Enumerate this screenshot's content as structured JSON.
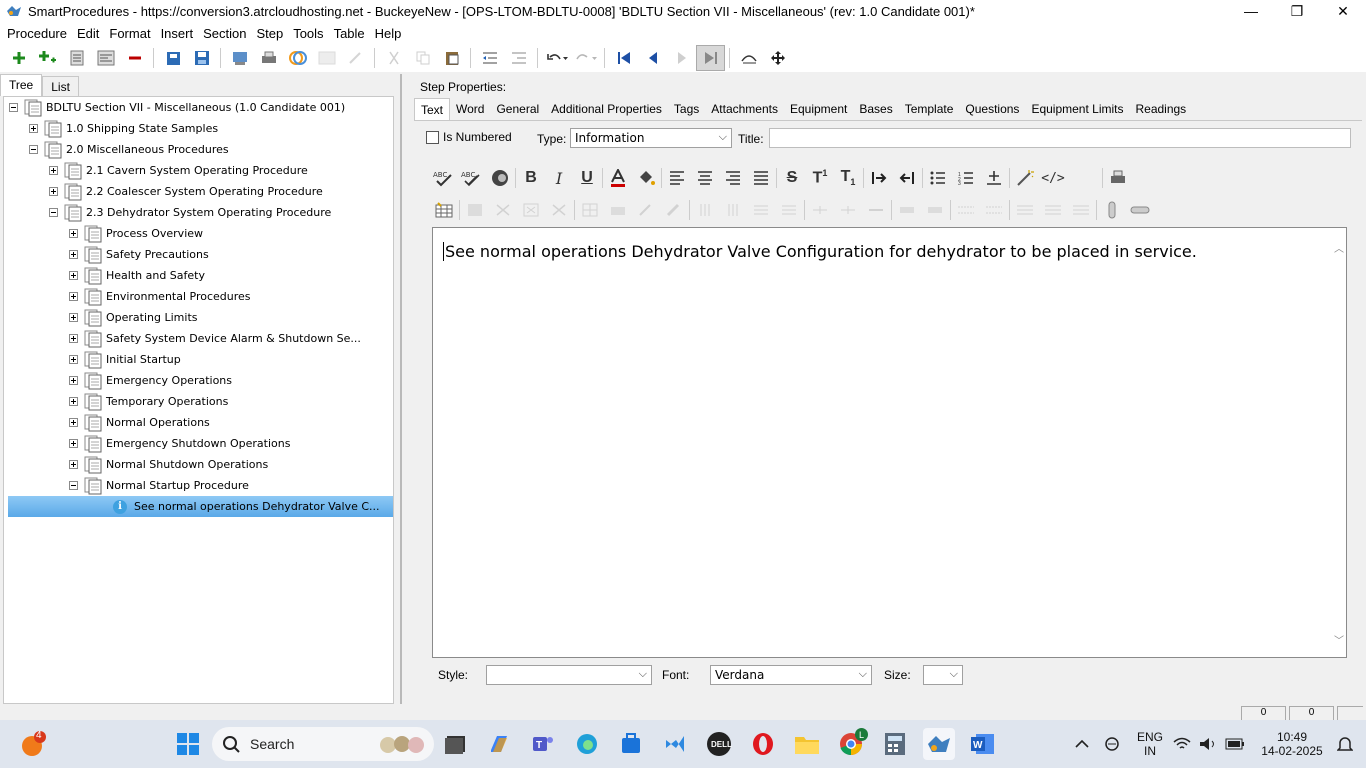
{
  "window": {
    "title": "SmartProcedures - https://conversion3.atrcloudhosting.net - BuckeyeNew - [OPS-LTOM-BDLTU-0008] 'BDLTU Section VII - Miscellaneous' (rev: 1.0 Candidate 001)*",
    "minimize": "—",
    "maximize": "❐",
    "close": "✕"
  },
  "menu": [
    "Procedure",
    "Edit",
    "Format",
    "Insert",
    "Section",
    "Step",
    "Tools",
    "Table",
    "Help"
  ],
  "left_tabs": [
    "Tree",
    "List"
  ],
  "tree": [
    {
      "label": "BDLTU Section VII - Miscellaneous (1.0 Candidate 001)",
      "level": 0,
      "state": "expanded"
    },
    {
      "label": "1.0 Shipping State Samples",
      "level": 1,
      "state": "collapsed"
    },
    {
      "label": "2.0 Miscellaneous Procedures",
      "level": 1,
      "state": "expanded"
    },
    {
      "label": "2.1 Cavern System Operating Procedure",
      "level": 2,
      "state": "collapsed"
    },
    {
      "label": "2.2 Coalescer System Operating Procedure",
      "level": 2,
      "state": "collapsed"
    },
    {
      "label": "2.3 Dehydrator System Operating Procedure",
      "level": 2,
      "state": "expanded"
    },
    {
      "label": "Process Overview",
      "level": 3,
      "state": "collapsed"
    },
    {
      "label": "Safety Precautions",
      "level": 3,
      "state": "collapsed"
    },
    {
      "label": "Health and Safety",
      "level": 3,
      "state": "collapsed"
    },
    {
      "label": "Environmental Procedures",
      "level": 3,
      "state": "collapsed"
    },
    {
      "label": "Operating Limits",
      "level": 3,
      "state": "collapsed"
    },
    {
      "label": "Safety System Device Alarm & Shutdown Se...",
      "level": 3,
      "state": "collapsed"
    },
    {
      "label": "Initial Startup",
      "level": 3,
      "state": "collapsed"
    },
    {
      "label": "Emergency Operations",
      "level": 3,
      "state": "collapsed"
    },
    {
      "label": "Temporary Operations",
      "level": 3,
      "state": "collapsed"
    },
    {
      "label": "Normal Operations",
      "level": 3,
      "state": "collapsed"
    },
    {
      "label": "Emergency Shutdown Operations",
      "level": 3,
      "state": "collapsed"
    },
    {
      "label": "Normal Shutdown Operations",
      "level": 3,
      "state": "collapsed"
    },
    {
      "label": "Normal Startup Procedure",
      "level": 3,
      "state": "expanded"
    },
    {
      "label": "See normal operations Dehydrator Valve C...",
      "level": 4,
      "state": "leaf-selected"
    }
  ],
  "step_properties": {
    "heading": "Step Properties:",
    "tabs": [
      "Text",
      "Word",
      "General",
      "Additional Properties",
      "Tags",
      "Attachments",
      "Equipment",
      "Bases",
      "Template",
      "Questions",
      "Equipment Limits",
      "Readings"
    ],
    "is_numbered_label": "Is Numbered",
    "type_label": "Type:",
    "type_value": "Information",
    "title_label": "Title:",
    "title_value": ""
  },
  "editor": {
    "text": "See normal operations Dehydrator Valve Configuration for dehydrator to be placed in service."
  },
  "bottom": {
    "style_label": "Style:",
    "style_value": "",
    "font_label": "Font:",
    "font_value": "Verdana",
    "size_label": "Size:",
    "size_value": ""
  },
  "status": {
    "cell1": "0",
    "cell2": "0"
  },
  "taskbar": {
    "search_label": "Search",
    "notification_count": "4",
    "chrome_badge": "L",
    "lang": "ENG",
    "region": "IN",
    "time": "10:49",
    "date": "14-02-2025"
  },
  "colors": {
    "selection": "#5aa9e8",
    "taskbar": "#dfe5ee",
    "accent_blue": "#1a5fb4"
  }
}
